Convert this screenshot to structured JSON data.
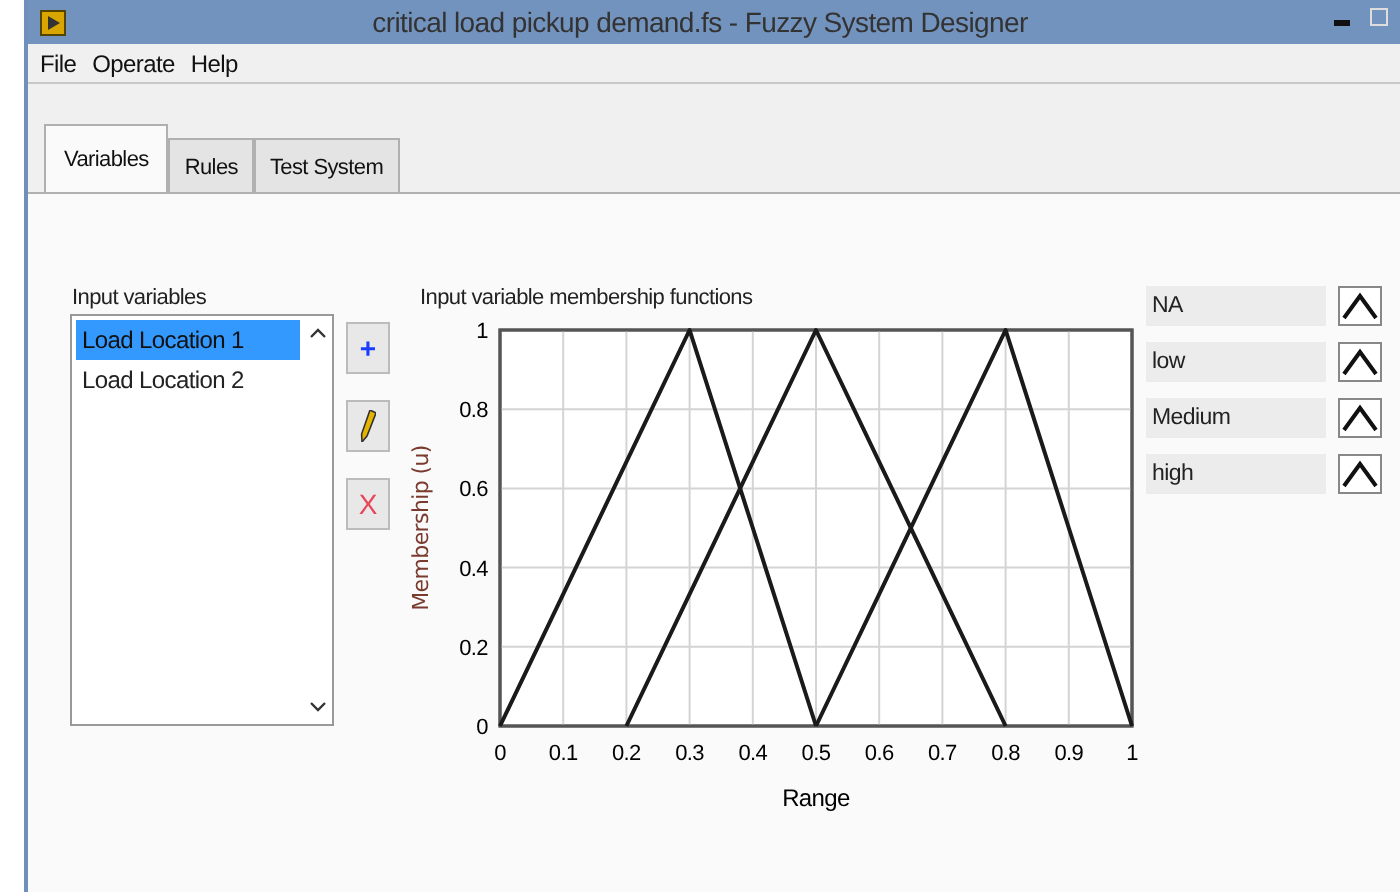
{
  "window": {
    "title": "critical load pickup demand.fs - Fuzzy System Designer"
  },
  "menu": [
    "File",
    "Operate",
    "Help"
  ],
  "tabs": [
    {
      "label": "Variables",
      "selected": true
    },
    {
      "label": "Rules",
      "selected": false
    },
    {
      "label": "Test System",
      "selected": false
    }
  ],
  "input_variables": {
    "label": "Input variables",
    "items": [
      {
        "label": "Load Location 1",
        "selected": true
      },
      {
        "label": "Load Location 2",
        "selected": false
      }
    ]
  },
  "edit_buttons": [
    {
      "kind": "add",
      "label": "+"
    },
    {
      "kind": "edit"
    },
    {
      "kind": "delete",
      "label": "X"
    }
  ],
  "chart": {
    "title": "Input variable membership functions",
    "chart_data": {
      "type": "line",
      "xlabel": "Range",
      "ylabel": "Membership (u)",
      "x": [
        0,
        0.1,
        0.2,
        0.3,
        0.4,
        0.5,
        0.6,
        0.7,
        0.8,
        0.9,
        1
      ],
      "series": [
        {
          "color": "#1a1a1a",
          "values": [
            0,
            0.333,
            0.667,
            1,
            0.5,
            0,
            null,
            null,
            null,
            null,
            null
          ]
        },
        {
          "color": "#1a1a1a",
          "values": [
            null,
            null,
            0,
            0.333,
            0.667,
            1,
            0.667,
            0.333,
            0,
            null,
            null
          ]
        },
        {
          "color": "#1a1a1a",
          "values": [
            null,
            null,
            null,
            null,
            null,
            0,
            0.333,
            0.667,
            1,
            0.5,
            0
          ]
        }
      ],
      "grid": true,
      "xlim": [
        0,
        1
      ],
      "ylim": [
        0,
        1
      ],
      "xticks": [
        0,
        0.1,
        0.2,
        0.3,
        0.4,
        0.5,
        0.6,
        0.7,
        0.8,
        0.9,
        1
      ],
      "yticks": [
        0,
        0.2,
        0.4,
        0.6,
        0.8,
        1
      ]
    }
  },
  "membership_functions": [
    {
      "label": "NA",
      "kind": "triangle"
    },
    {
      "label": "low",
      "kind": "triangle"
    },
    {
      "label": "Medium",
      "kind": "triangle"
    },
    {
      "label": "high",
      "kind": "triangle"
    }
  ]
}
